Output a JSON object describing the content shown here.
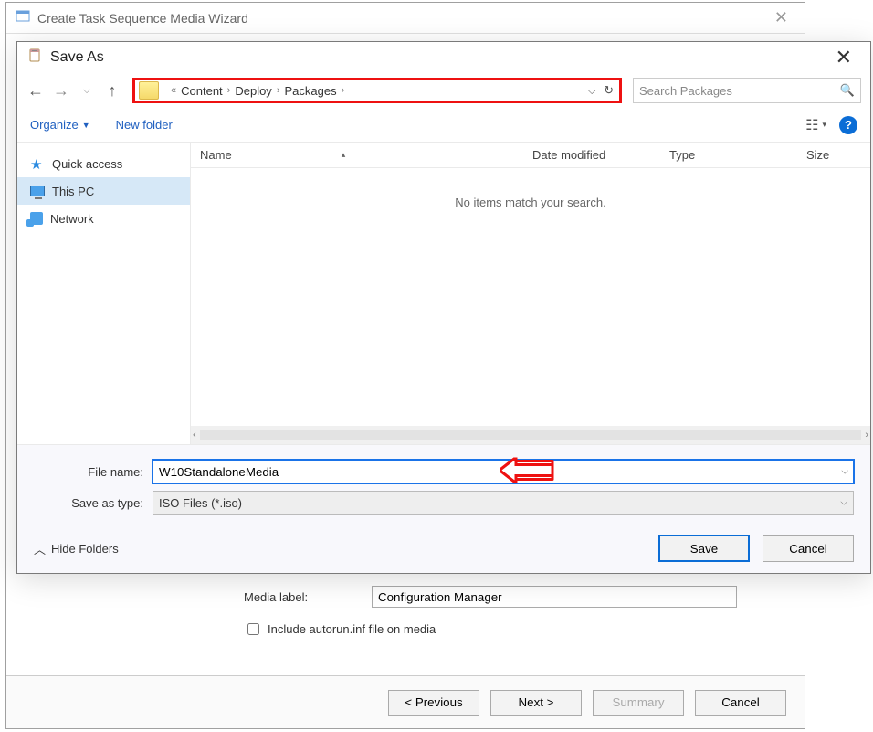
{
  "wizard": {
    "title": "Create Task Sequence Media Wizard",
    "media_label_caption": "Media label:",
    "media_label_value": "Configuration Manager",
    "include_autorun_label": "Include autorun.inf file on media",
    "buttons": {
      "previous": "< Previous",
      "next": "Next >",
      "summary": "Summary",
      "cancel": "Cancel"
    }
  },
  "saveas": {
    "title": "Save As",
    "breadcrumbs": [
      "Content",
      "Deploy",
      "Packages"
    ],
    "search_placeholder": "Search Packages",
    "organize_label": "Organize",
    "newfolder_label": "New folder",
    "sidebar": {
      "quick_access": "Quick access",
      "this_pc": "This PC",
      "network": "Network"
    },
    "columns": {
      "name": "Name",
      "date": "Date modified",
      "type": "Type",
      "size": "Size"
    },
    "empty_message": "No items match your search.",
    "filename_label": "File name:",
    "filename_value": "W10StandaloneMedia",
    "saveastype_label": "Save as type:",
    "saveastype_value": "ISO Files (*.iso)",
    "hide_folders_label": "Hide Folders",
    "buttons": {
      "save": "Save",
      "cancel": "Cancel"
    }
  }
}
